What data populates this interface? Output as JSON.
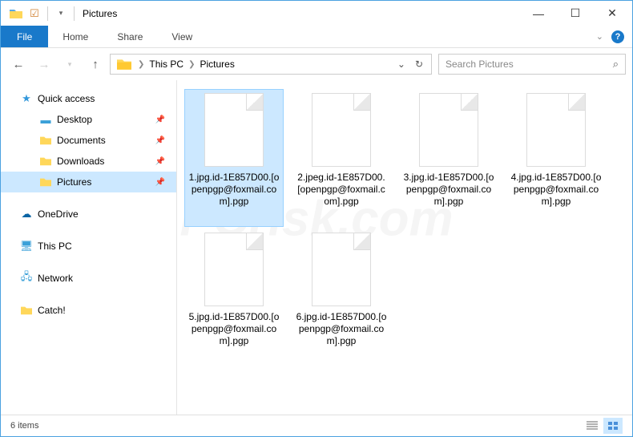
{
  "titlebar": {
    "title": "Pictures"
  },
  "window_controls": {
    "minimize": "—",
    "maximize": "☐",
    "close": "✕"
  },
  "ribbon": {
    "file": "File",
    "tabs": [
      "Home",
      "Share",
      "View"
    ]
  },
  "breadcrumb": {
    "items": [
      "This PC",
      "Pictures"
    ]
  },
  "search": {
    "placeholder": "Search Pictures"
  },
  "sidebar": {
    "quick_access": "Quick access",
    "quick_items": [
      {
        "label": "Desktop",
        "pinned": true
      },
      {
        "label": "Documents",
        "pinned": true
      },
      {
        "label": "Downloads",
        "pinned": true
      },
      {
        "label": "Pictures",
        "pinned": true,
        "selected": true
      }
    ],
    "onedrive": "OneDrive",
    "thispc": "This PC",
    "network": "Network",
    "catch": "Catch!"
  },
  "files": [
    {
      "name": "1.jpg.id-1E857D00.[openpgp@foxmail.com].pgp",
      "selected": true
    },
    {
      "name": "2.jpeg.id-1E857D00.[openpgp@foxmail.com].pgp"
    },
    {
      "name": "3.jpg.id-1E857D00.[openpgp@foxmail.com].pgp"
    },
    {
      "name": "4.jpg.id-1E857D00.[openpgp@foxmail.com].pgp"
    },
    {
      "name": "5.jpg.id-1E857D00.[openpgp@foxmail.com].pgp"
    },
    {
      "name": "6.jpg.id-1E857D00.[openpgp@foxmail.com].pgp"
    }
  ],
  "statusbar": {
    "count": "6 items"
  },
  "watermark": "PCrisk.com"
}
